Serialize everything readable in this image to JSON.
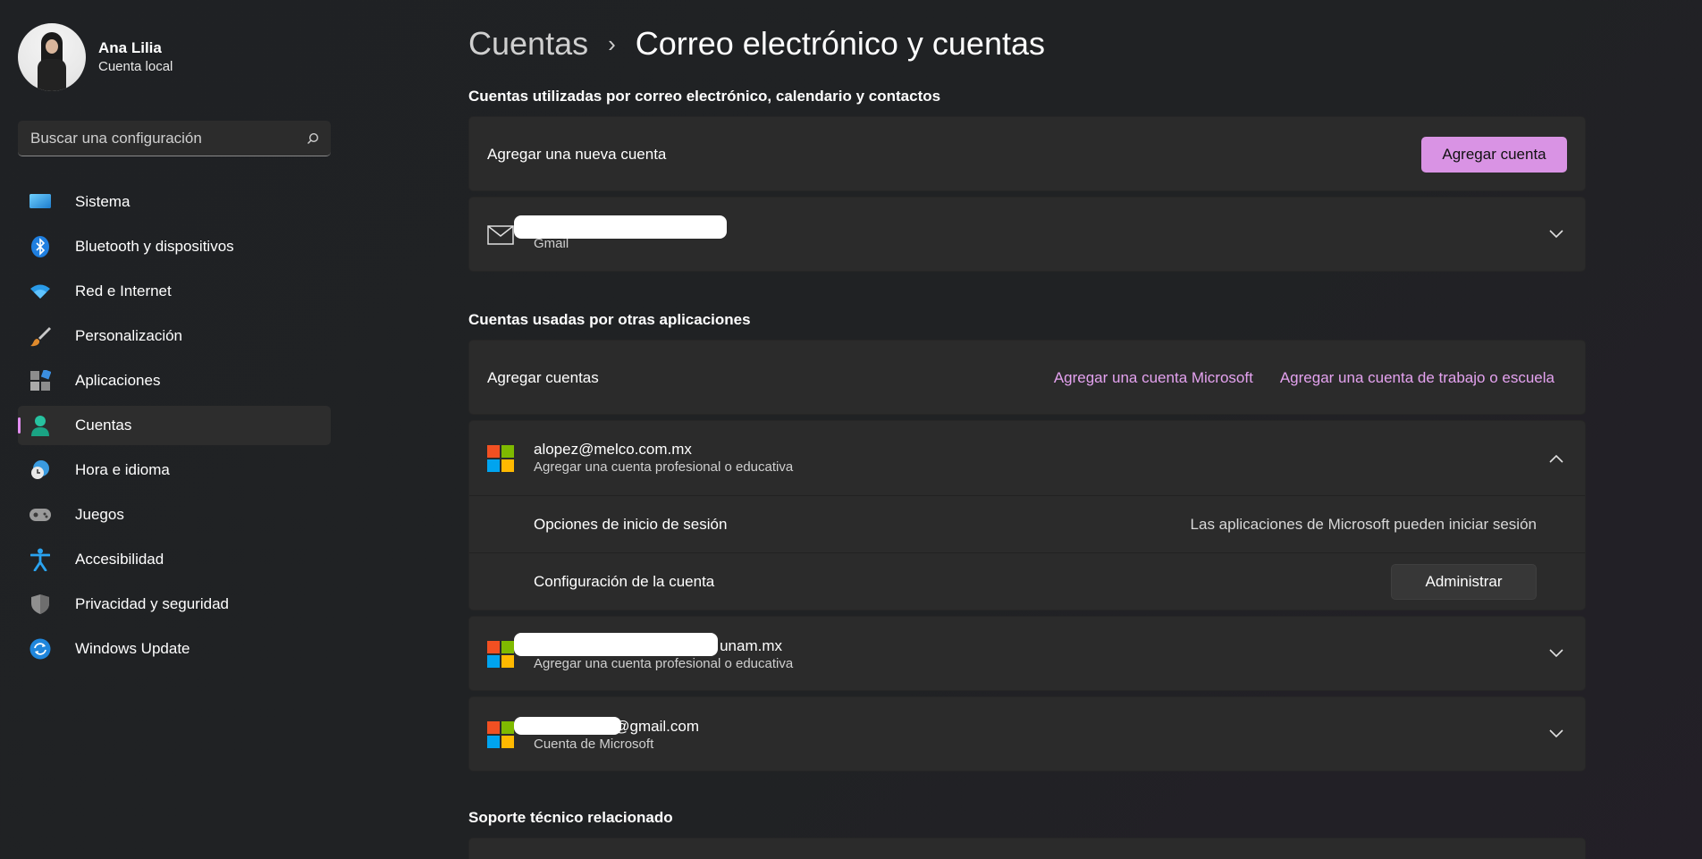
{
  "profile": {
    "name": "Ana Lilia",
    "subtitle": "Cuenta local"
  },
  "search": {
    "placeholder": "Buscar una configuración"
  },
  "nav": [
    {
      "label": "Sistema",
      "icon": "system-icon"
    },
    {
      "label": "Bluetooth y dispositivos",
      "icon": "bluetooth-icon"
    },
    {
      "label": "Red e Internet",
      "icon": "wifi-icon"
    },
    {
      "label": "Personalización",
      "icon": "brush-icon"
    },
    {
      "label": "Aplicaciones",
      "icon": "apps-icon"
    },
    {
      "label": "Cuentas",
      "icon": "accounts-icon",
      "selected": true
    },
    {
      "label": "Hora e idioma",
      "icon": "clock-globe-icon"
    },
    {
      "label": "Juegos",
      "icon": "gamepad-icon"
    },
    {
      "label": "Accesibilidad",
      "icon": "accessibility-icon"
    },
    {
      "label": "Privacidad y seguridad",
      "icon": "shield-icon"
    },
    {
      "label": "Windows Update",
      "icon": "update-icon"
    }
  ],
  "breadcrumb": {
    "parent": "Cuentas",
    "separator": "›",
    "current": "Correo electrónico y cuentas"
  },
  "email_section": {
    "title": "Cuentas utilizadas por correo electrónico, calendario y contactos",
    "add_row_label": "Agregar una nueva cuenta",
    "add_button": "Agregar cuenta",
    "accounts": [
      {
        "provider": "Gmail"
      }
    ]
  },
  "apps_section": {
    "title": "Cuentas usadas por otras aplicaciones",
    "add_row_label": "Agregar cuentas",
    "link_microsoft": "Agregar una cuenta Microsoft",
    "link_work": "Agregar una cuenta de trabajo o escuela",
    "expanded_account": {
      "email": "alopez@melco.com.mx",
      "type": "Agregar una cuenta profesional o educativa",
      "signin_label": "Opciones de inicio de sesión",
      "signin_value": "Las aplicaciones de Microsoft pueden iniciar sesión",
      "config_label": "Configuración de la cuenta",
      "manage_button": "Administrar"
    },
    "account2": {
      "email_suffix": "unam.mx",
      "type": "Agregar una cuenta profesional o educativa"
    },
    "account3": {
      "email_suffix": "@gmail.com",
      "type": "Cuenta de Microsoft"
    }
  },
  "support_section": {
    "title": "Soporte técnico relacionado"
  },
  "colors": {
    "accent": "#d993e4",
    "link": "#e4a2ef",
    "card": "#2b2b2b",
    "background": "#202020"
  }
}
